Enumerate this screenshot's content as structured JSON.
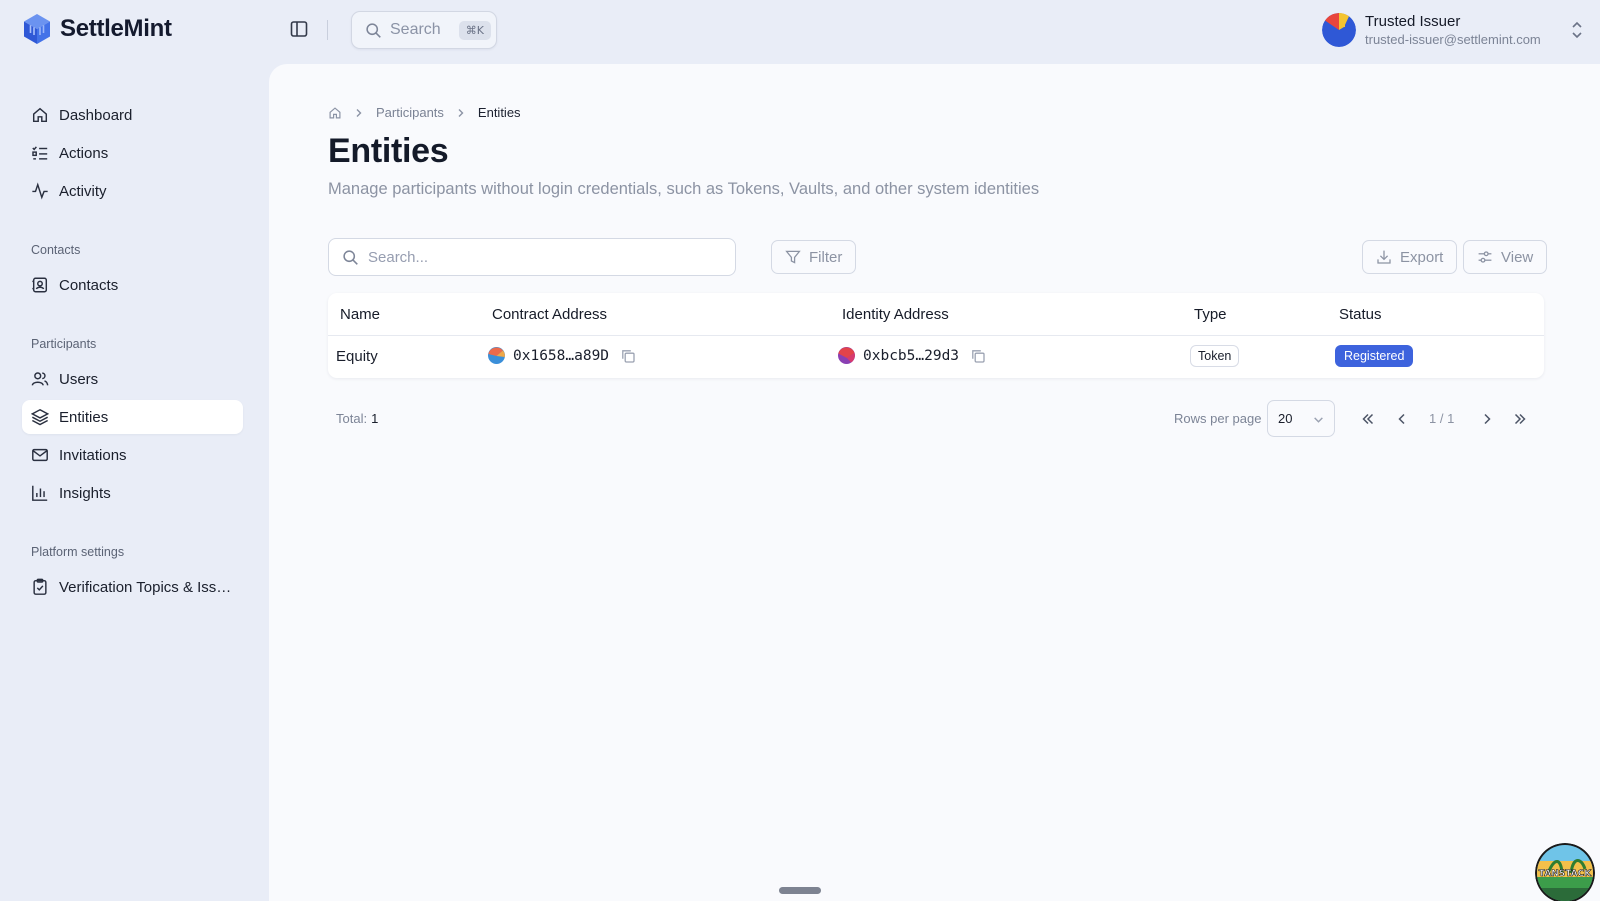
{
  "app": {
    "brand": "SettleMint"
  },
  "topbar": {
    "search_label": "Search",
    "search_shortcut": "⌘K",
    "user": {
      "name": "Trusted Issuer",
      "email": "trusted-issuer@settlemint.com"
    }
  },
  "sidebar": {
    "main": [
      {
        "label": "Dashboard",
        "icon": "home-icon"
      },
      {
        "label": "Actions",
        "icon": "list-checks-icon"
      },
      {
        "label": "Activity",
        "icon": "activity-icon"
      }
    ],
    "groups": {
      "contacts": "Contacts",
      "participants": "Participants",
      "platform": "Platform settings"
    },
    "contacts_item": {
      "label": "Contacts",
      "icon": "contact-book-icon"
    },
    "participants_items": [
      {
        "label": "Users",
        "icon": "users-icon"
      },
      {
        "label": "Entities",
        "icon": "layers-icon",
        "active": true
      },
      {
        "label": "Invitations",
        "icon": "mail-icon"
      },
      {
        "label": "Insights",
        "icon": "bar-chart-icon"
      }
    ],
    "platform_item": {
      "label": "Verification Topics & Issu...",
      "icon": "clipboard-check-icon"
    }
  },
  "breadcrumb": {
    "home_icon": "home-icon",
    "items": [
      "Participants"
    ],
    "current": "Entities"
  },
  "page": {
    "title": "Entities",
    "description": "Manage participants without login credentials, such as Tokens, Vaults, and other system identities"
  },
  "toolbar": {
    "search_placeholder": "Search...",
    "filter_label": "Filter",
    "export_label": "Export",
    "view_label": "View"
  },
  "table": {
    "columns": [
      "Name",
      "Contract Address",
      "Identity Address",
      "Type",
      "Status"
    ],
    "rows": [
      {
        "name": "Equity",
        "contract_address": "0x1658…a89D",
        "identity_address": "0xbcb5…29d3",
        "type": "Token",
        "status": "Registered"
      }
    ]
  },
  "pagination": {
    "total_label": "Total:",
    "total": "1",
    "rows_per_page_label": "Rows per page",
    "rows_per_page": "20",
    "page_indicator": "1 / 1"
  },
  "devtools": {
    "badge_text": "TANSTACK"
  },
  "colors": {
    "accent": "#3d63dd",
    "sidebar_bg": "#e9edf7",
    "panel_bg": "#f9fafd"
  }
}
